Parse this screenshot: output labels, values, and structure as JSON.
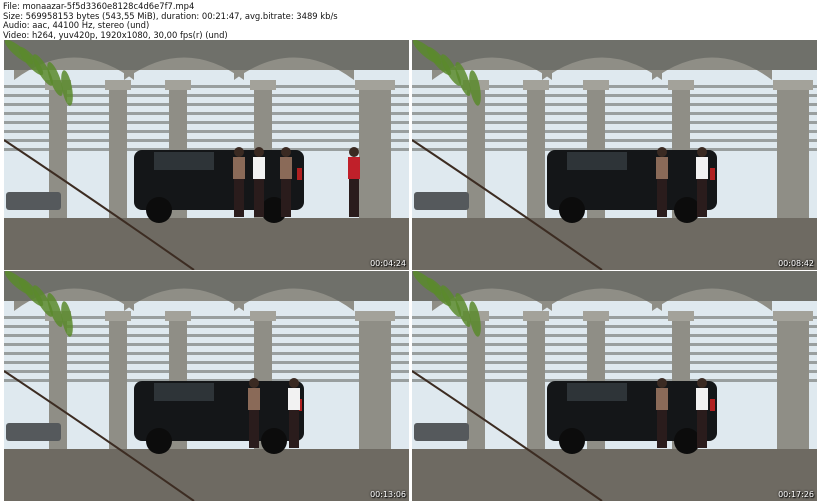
{
  "header": {
    "file": "File: monaazar-5f5d3360e8128c4d6e7f7.mp4",
    "size": "Size: 569958153 bytes (543,55 MiB), duration: 00:21:47, avg.bitrate: 3489 kb/s",
    "audio": "Audio: aac, 44100 Hz, stereo (und)",
    "video": "Video: h264, yuv420p, 1920x1080, 30,00 fps(r) (und)"
  },
  "thumbnails": [
    {
      "timestamp": "00:04:24",
      "icon": "video-frame-underpass-parking"
    },
    {
      "timestamp": "00:08:42",
      "icon": "video-frame-underpass-parking"
    },
    {
      "timestamp": "00:13:06",
      "icon": "video-frame-underpass-parking"
    },
    {
      "timestamp": "00:17:26",
      "icon": "video-frame-underpass-parking"
    }
  ],
  "colors": {
    "sky": "#dfe9ef",
    "concrete": "#8f8e86",
    "ground": "#6e6a62",
    "car": "#141618",
    "foliage": "#5a8a2c"
  }
}
